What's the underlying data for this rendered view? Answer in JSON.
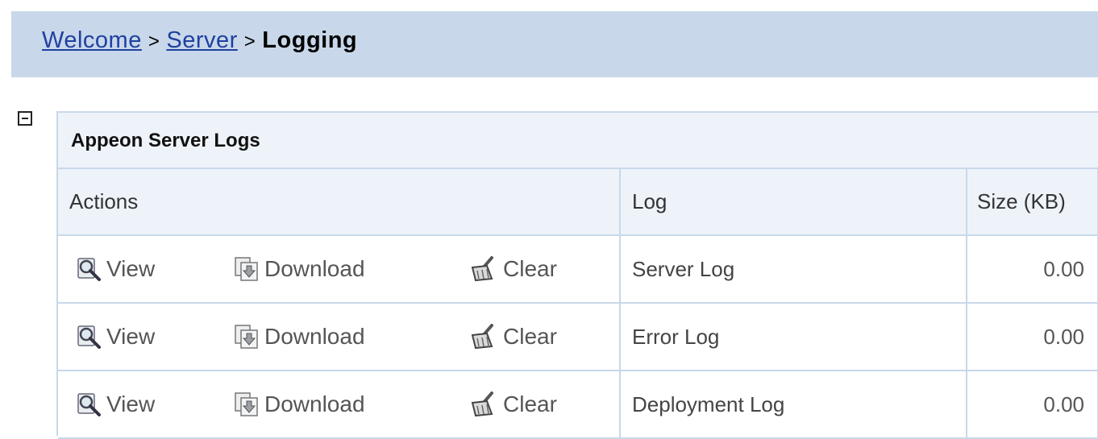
{
  "breadcrumb": {
    "items": [
      "Welcome",
      "Server"
    ],
    "separator": ">",
    "current": "Logging"
  },
  "panel": {
    "title": "Appeon Server Logs",
    "columns": {
      "actions": "Actions",
      "log": "Log",
      "size": "Size (KB)"
    },
    "action_labels": {
      "view": "View",
      "download": "Download",
      "clear": "Clear"
    },
    "rows": [
      {
        "log": "Server Log",
        "size": "0.00"
      },
      {
        "log": "Error Log",
        "size": "0.00"
      },
      {
        "log": "Deployment Log",
        "size": "0.00"
      }
    ]
  },
  "icons": {
    "collapse": "minus-box-icon",
    "view": "magnifier-icon",
    "download": "download-doc-icon",
    "clear": "broom-icon"
  },
  "colors": {
    "header_bg": "#c8d8ea",
    "panel_header_bg": "#eef3fa",
    "link": "#2040a0",
    "border": "#c8d8ea"
  }
}
